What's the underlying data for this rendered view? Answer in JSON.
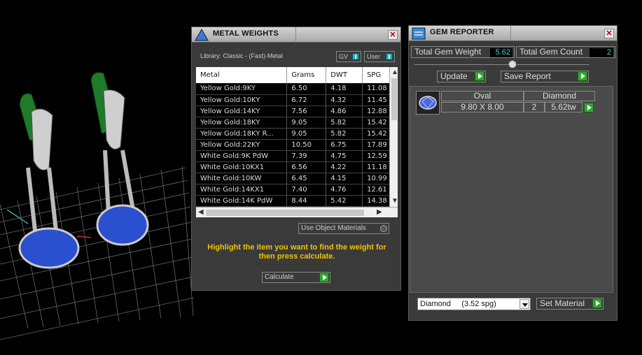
{
  "metal_weights": {
    "title": "METAL WEIGHTS",
    "library": "Library: Classic - (Fast)-Metal",
    "toggle_gv": "GV",
    "toggle_user": "User",
    "columns": [
      "Metal",
      "Grams",
      "DWT",
      "SPG"
    ],
    "rows": [
      [
        "Yellow Gold:9KY",
        "6.50",
        "4.18",
        "11.08"
      ],
      [
        "Yellow Gold:10KY",
        "6.72",
        "4.32",
        "11.45"
      ],
      [
        "Yellow Gold:14KY",
        "7.56",
        "4.86",
        "12.88"
      ],
      [
        "Yellow Gold:18KY",
        "9.05",
        "5.82",
        "15.42"
      ],
      [
        "Yellow Gold:18KY R...",
        "9.05",
        "5.82",
        "15.42"
      ],
      [
        "Yellow Gold:22KY",
        "10.50",
        "6.75",
        "17.89"
      ],
      [
        "White Gold:9K PdW",
        "7.39",
        "4.75",
        "12.59"
      ],
      [
        "White Gold:10KX1",
        "6.56",
        "4.22",
        "11.18"
      ],
      [
        "White Gold:10KW",
        "6.45",
        "4.15",
        "10.99"
      ],
      [
        "White Gold:14KX1",
        "7.40",
        "4.76",
        "12.61"
      ],
      [
        "White Gold:14K PdW",
        "8.44",
        "5.42",
        "14.38"
      ]
    ],
    "use_object_materials": "Use Object Materials",
    "hint": "Highlight the item you want to find the weight for then press calculate.",
    "calculate": "Calculate"
  },
  "gem_reporter": {
    "title": "GEM REPORTER",
    "total_weight_label": "Total Gem Weight",
    "total_weight_value": "5.62",
    "total_count_label": "Total Gem Count",
    "total_count_value": "2",
    "update": "Update",
    "save_report": "Save Report",
    "gem": {
      "shape": "Oval",
      "material": "Diamond",
      "size": "9.80 X 8.00",
      "count": "2",
      "weight": "5.62tw"
    },
    "material_select": "Diamond     (3.52 spg)",
    "set_material": "Set Material"
  }
}
